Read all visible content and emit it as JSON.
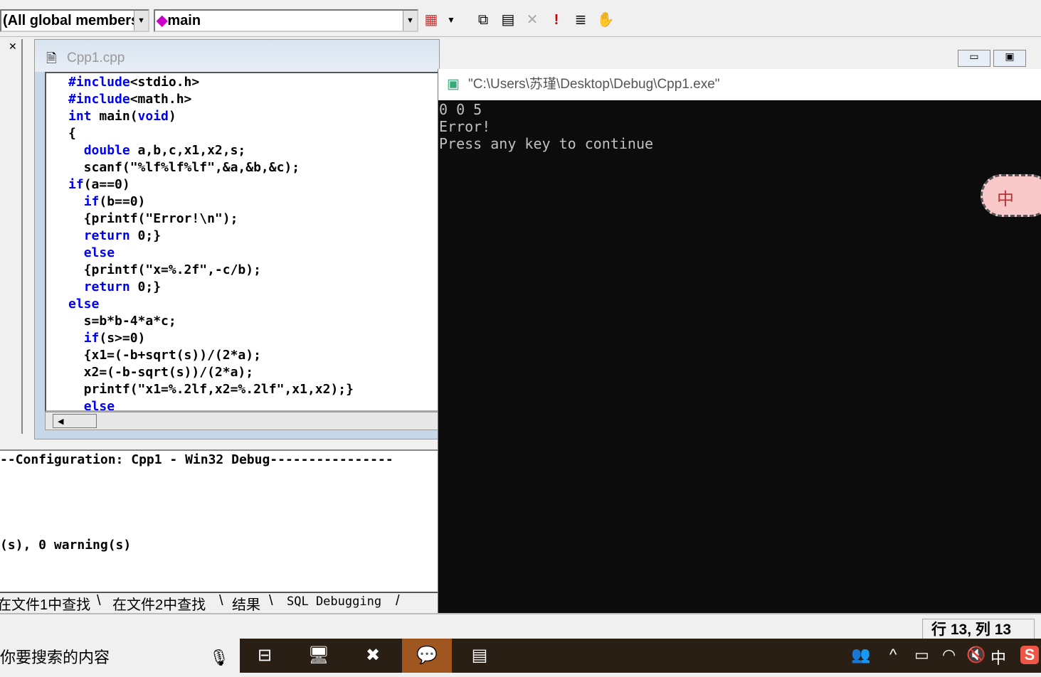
{
  "toolbar": {
    "scope_combo": "(All global members",
    "function_combo": "main",
    "icons": [
      "wizard-icon",
      "compile-icon",
      "build-icon",
      "stop-build-icon",
      "execute-icon",
      "breakpoint-list-icon",
      "hand-icon"
    ]
  },
  "editor": {
    "title": "Cpp1.cpp",
    "lines": [
      [
        [
          "#include",
          "kw"
        ],
        [
          "<stdio.h>",
          ""
        ]
      ],
      [
        [
          "#include",
          "kw"
        ],
        [
          "<math.h>",
          ""
        ]
      ],
      [
        [
          "int",
          "kw"
        ],
        [
          " main(",
          ""
        ],
        [
          "void",
          "kw"
        ],
        [
          ")",
          ""
        ]
      ],
      [
        [
          "{",
          ""
        ]
      ],
      [
        [
          "  ",
          ""
        ],
        [
          "double",
          "kw"
        ],
        [
          " a,b,c,x1,x2,s;",
          ""
        ]
      ],
      [
        [
          "  scanf(\"%lf%lf%lf\",&a,&b,&c);",
          ""
        ]
      ],
      [
        [
          "if",
          "kw"
        ],
        [
          "(a==0)",
          ""
        ]
      ],
      [
        [
          "  ",
          ""
        ],
        [
          "if",
          "kw"
        ],
        [
          "(b==0)",
          ""
        ]
      ],
      [
        [
          "  {printf(\"Error!\\n\");",
          ""
        ]
      ],
      [
        [
          "  ",
          ""
        ],
        [
          "return",
          "kw"
        ],
        [
          " 0;}",
          ""
        ]
      ],
      [
        [
          "  ",
          ""
        ],
        [
          "else",
          "kw"
        ]
      ],
      [
        [
          "  {printf(\"x=%.2f\",-c/b);",
          ""
        ]
      ],
      [
        [
          "  ",
          ""
        ],
        [
          "return",
          "kw"
        ],
        [
          " 0;}",
          ""
        ]
      ],
      [
        [
          "else",
          "kw"
        ]
      ],
      [
        [
          "  s=b*b-4*a*c;",
          ""
        ]
      ],
      [
        [
          "  ",
          ""
        ],
        [
          "if",
          "kw"
        ],
        [
          "(s>=0)",
          ""
        ]
      ],
      [
        [
          "  {x1=(-b+sqrt(s))/(2*a);",
          ""
        ]
      ],
      [
        [
          "  x2=(-b-sqrt(s))/(2*a);",
          ""
        ]
      ],
      [
        [
          "  printf(\"x1=%.2lf,x2=%.2lf\",x1,x2);}",
          ""
        ]
      ],
      [
        [
          "  ",
          ""
        ],
        [
          "else",
          "kw"
        ]
      ]
    ]
  },
  "output": {
    "lines": [
      "--Configuration: Cpp1 - Win32 Debug----------------",
      "(s), 0 warning(s)"
    ],
    "tabs": [
      "在文件1中查找",
      "在文件2中查找",
      "结果",
      "SQL Debugging"
    ]
  },
  "console": {
    "title": "\"C:\\Users\\苏瑾\\Desktop\\Debug\\Cpp1.exe\"",
    "lines": [
      "0 0 5",
      "Error!",
      "Press any key to continue"
    ]
  },
  "ime": {
    "label": "中"
  },
  "status": {
    "position": "行 13, 列 13"
  },
  "taskbar": {
    "search_placeholder": "你要搜索的内容",
    "tray_ime": "中"
  },
  "colors": {
    "keyword": "#0000ff",
    "console_bg": "#0c0c0c",
    "taskbar": "#2a1f15"
  }
}
